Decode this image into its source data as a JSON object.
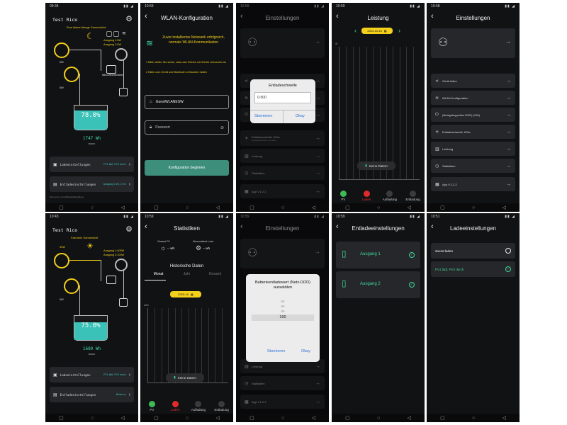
{
  "screens": {
    "home1": {
      "time": "09:34",
      "device_name": "Test Rico",
      "banner": "Eine kleine Menge Sonnenlicht",
      "out1": "Ausgang 1:0W",
      "out2": "Ausgang 2:0W",
      "pv_label": "0W",
      "pv_label2": "0W",
      "pv_label3": "0W",
      "bat_label": "0W",
      "percent": "78.0%",
      "wh": "1747 Wh",
      "wh_unit": "800Wh",
      "micro_label": "Mikro-Wechselrichter",
      "lade_label": "Ladeeinstellungen",
      "lade_val": "PV1 lädt, PV2 durch",
      "entlade_label": "Entladeeinstellungen",
      "entlade_val": "Ausgang 1 ein, 2 ein",
      "footer": "Dies ist nur eine Beispieldarstellung"
    },
    "wlan": {
      "time": "10:59",
      "title": "WLAN-Konfiguration",
      "warning": "Zuvor installiertes Netzwerk erfolgreich, normale WLAN-Kommunikation",
      "step1": "1 Bitte stellen Sie sicher, dass das Telefon mit WLAN verbunden ist",
      "step2": "2 Nähe zum Gerät und Bluetooth verbunden halten",
      "ssid": "GuestWLANESW",
      "password_placeholder": "Passwort",
      "button": "Konfiguration beginnen"
    },
    "settings_dialog": {
      "time": "10:59",
      "title": "Einstellungen",
      "dialog_title": "Entladeschwelle",
      "dialog_value": "0-500",
      "cancel": "Stornieren",
      "ok": "Okay",
      "row_threshold": "Entladeschwelle 100w",
      "row_threshold_sub": "Entladeschwelle einstellen",
      "row_power": "Leistung",
      "row_stats": "Statistiken",
      "row_app": "App V.1.2.2"
    },
    "leistung": {
      "time": "10:59",
      "title": "Leistung",
      "date": "2023-10-16",
      "y_unit": "W",
      "no_data": "Keine Daten!",
      "tabs": [
        "PV",
        "Laden",
        "Aufladung",
        "Entladung"
      ],
      "tab_colors": [
        "#3dbb55",
        "#e02b2b",
        "#3a3b3d",
        "#3a3b3d"
      ]
    },
    "settings_full": {
      "time": "10:58",
      "title": "Einstellungen",
      "items": [
        {
          "icon": "share-icon",
          "label": "Gerät teilen"
        },
        {
          "icon": "wifi-icon",
          "label": "WLAN-Konfiguration"
        },
        {
          "icon": "plug-icon",
          "label": "(Netzgekoppeltes DOD)  (100)"
        },
        {
          "icon": "sun-icon",
          "label": "Entladeschwelle 100w"
        },
        {
          "icon": "chart-icon",
          "label": "Leistung"
        },
        {
          "icon": "clock-icon",
          "label": "Statistiken"
        },
        {
          "icon": "app-icon",
          "label": "App V.1.2.2"
        }
      ]
    },
    "home2": {
      "time": "10:43",
      "device_name": "Test Rico",
      "banner": "Fast kein Sonnenlicht",
      "out1": "Ausgang 1:403W",
      "out2": "Ausgang 2:100W",
      "pv_label": "33W",
      "pv_label2": "0W",
      "percent": "75.0%",
      "wh": "1680 Wh",
      "wh_unit": "800Wh",
      "lade_label": "Ladeeinstellungen",
      "lade_val": "PV1 lädt, PV2 durch",
      "entlade_label": "Entladeeinstellungen",
      "entlade_val": "Beide an"
    },
    "statistiken": {
      "time": "10:59",
      "title": "Statistiken",
      "pv_total_label": "Gesamt PV",
      "pv_total_val": "-- wh",
      "load_label": "Akkumulated Load",
      "load_val": "-- wh",
      "hist_title": "Historische Daten",
      "tabs": [
        "Monat",
        "Jahr",
        "Gesamt"
      ],
      "date": "2023-10",
      "y_unit": "kWh",
      "no_data": "Keine Daten!",
      "bottom_tabs": [
        "PV",
        "Laden",
        "Aufladung",
        "Entladung"
      ]
    },
    "dod_dialog": {
      "time": "10:59",
      "title": "Einstellungen",
      "dialog_title": "Batterieentladewert (Netz-DOD) auswählen",
      "values": [
        "95",
        "98",
        "99",
        "100"
      ],
      "cancel": "Stornieren",
      "ok": "Okay",
      "row_power": "Leistung",
      "row_stats": "Statistiken",
      "row_app": "App V.1.2.2"
    },
    "entlade": {
      "time": "10:59",
      "title": "Entladeeinstellungen",
      "out1": "Ausgang 1",
      "out2": "Ausgang 2"
    },
    "lade": {
      "time": "10:51",
      "title": "Ladeeinstellungen",
      "opt1": "Zuerst laden",
      "opt2": "PV1 lädt, PV2 durch"
    }
  },
  "chart_data": [
    {
      "type": "bar",
      "title": "Leistung",
      "ylabel": "W",
      "categories": [],
      "values": [],
      "note_text": "Keine Daten!"
    },
    {
      "type": "bar",
      "title": "Historische Daten",
      "ylabel": "kWh",
      "categories": [],
      "values": [],
      "note_text": "Keine Daten!"
    }
  ]
}
